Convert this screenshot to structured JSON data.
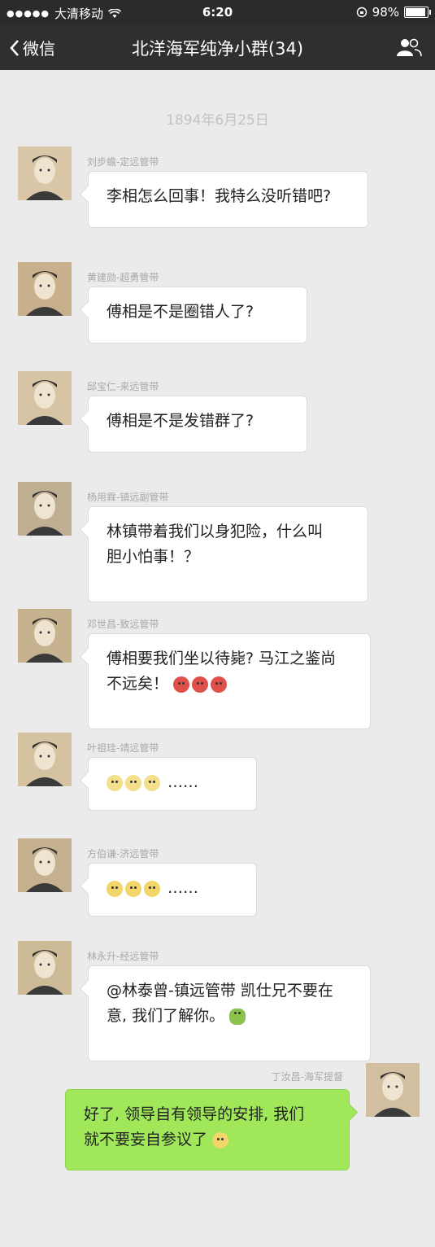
{
  "statusbar": {
    "signal_dots": "●●●●●",
    "carrier": "大清移动",
    "time": "6:20",
    "battery": "98%",
    "battery_level": 0.98
  },
  "navbar": {
    "back_label": "微信",
    "title": "北洋海军纯净小群(34)"
  },
  "date_divider": "1894年6月25日",
  "messages": [
    {
      "sender": "刘步蟾-定远管带",
      "lines": [
        "李相怎么回事！我特么没听错吧?"
      ],
      "emojis": [],
      "avatar": "avatar-liu"
    },
    {
      "sender": "黄建勋-超勇管带",
      "lines": [
        "傅相是不是圈错人了?"
      ],
      "emojis": [],
      "avatar": "avatar-huang"
    },
    {
      "sender": "邱宝仁-来远管带",
      "lines": [
        "傅相是不是发错群了?"
      ],
      "emojis": [],
      "avatar": "avatar-qiu"
    },
    {
      "sender": "杨用霖-镇远副管带",
      "lines": [
        "林镇带着我们以身犯险，什么叫",
        "胆小怕事！？"
      ],
      "emojis": [],
      "avatar": "avatar-yang"
    },
    {
      "sender": "邓世昌-致远管带",
      "lines": [
        "傅相要我们坐以待毙? 马江之鉴尚",
        "不远矣！"
      ],
      "emojis": [
        "angry",
        "angry",
        "angry"
      ],
      "avatar": "avatar-deng"
    },
    {
      "sender": "叶祖珪-靖远管带",
      "lines": [
        "……"
      ],
      "emojis": [
        "pale",
        "pale",
        "pale"
      ],
      "avatar": "avatar-ye"
    },
    {
      "sender": "方伯谦-济远管带",
      "lines": [
        "……"
      ],
      "emojis": [
        "sweat",
        "sweat",
        "sweat"
      ],
      "avatar": "avatar-fang"
    },
    {
      "sender": "林永升-经远管带",
      "lines": [
        "@林泰曾-镇远管带 凯仕兄不要在",
        "意, 我们了解你。"
      ],
      "emojis": [
        "frog"
      ],
      "avatar": "avatar-lin"
    },
    {
      "sender": "丁汝昌-海军提督",
      "lines": [
        "好了, 领导自有领导的安排, 我们",
        "就不要妄自参议了"
      ],
      "emojis": [
        "sweat"
      ],
      "avatar": "avatar-ding",
      "self": true
    }
  ]
}
